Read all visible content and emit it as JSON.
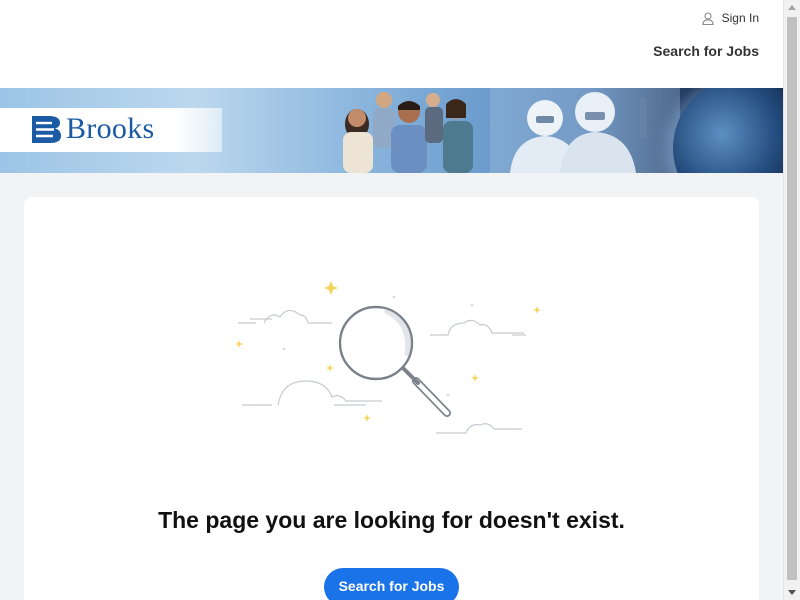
{
  "header": {
    "signin_label": "Sign In",
    "search_jobs_label": "Search for Jobs",
    "text_color": "#333333"
  },
  "banner": {
    "logo_text": "Brooks",
    "logo_color": "#1b5ba5"
  },
  "main": {
    "message": "The page you are looking for doesn't exist.",
    "cta_label": "Search for Jobs",
    "accent_color": "#1a73e8",
    "illustration_icon": "magnifying-glass-icon"
  }
}
